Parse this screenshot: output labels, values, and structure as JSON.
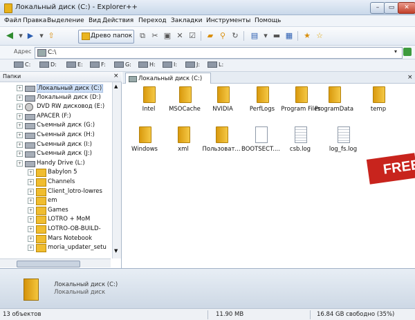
{
  "window": {
    "title": "Локальный диск (C:) - Explorer++"
  },
  "menu": [
    "Файл",
    "Правка",
    "Выделение",
    "Вид",
    "Действия",
    "Переход",
    "Закладки",
    "Инструменты",
    "Помощь"
  ],
  "toolbar": {
    "folders_button": "Древо папок"
  },
  "address": {
    "label": "Адрес",
    "value": "C:\\"
  },
  "drives": [
    "C:",
    "D:",
    "E:",
    "F:",
    "G:",
    "H:",
    "I:",
    "J:",
    "L:"
  ],
  "folders_pane": {
    "title": "Папки",
    "close": "×",
    "items": [
      {
        "label": "Локальный диск (C:)",
        "icon": "drive"
      },
      {
        "label": "Локальный диск (D:)",
        "icon": "drive"
      },
      {
        "label": "DVD RW дисковод (E:)",
        "icon": "cd"
      },
      {
        "label": "APACER (F:)",
        "icon": "drive"
      },
      {
        "label": "Съемный диск (G:)",
        "icon": "drive"
      },
      {
        "label": "Съемный диск (H:)",
        "icon": "drive"
      },
      {
        "label": "Съемный диск (I:)",
        "icon": "drive"
      },
      {
        "label": "Съемный диск (J:)",
        "icon": "drive"
      },
      {
        "label": "Handy Drive (L:)",
        "icon": "drive"
      },
      {
        "label": "Babylon 5",
        "icon": "folder"
      },
      {
        "label": "Channels",
        "icon": "folder"
      },
      {
        "label": "Client_lotro-lowres",
        "icon": "folder"
      },
      {
        "label": "em",
        "icon": "folder"
      },
      {
        "label": "Games",
        "icon": "folder"
      },
      {
        "label": "LOTRO + MoM",
        "icon": "folder"
      },
      {
        "label": "LOTRO-OB-BUILD-",
        "icon": "folder"
      },
      {
        "label": "Mars Notebook",
        "icon": "folder"
      },
      {
        "label": "moria_updater_setu",
        "icon": "folder"
      }
    ]
  },
  "tab": {
    "label": "Локальный диск (C:)",
    "close": "×"
  },
  "files": [
    {
      "name": "Intel",
      "type": "folder"
    },
    {
      "name": "MSOCache",
      "type": "folder"
    },
    {
      "name": "NVIDIA",
      "type": "folder"
    },
    {
      "name": "PerfLogs",
      "type": "folder"
    },
    {
      "name": "Program Files",
      "type": "folder"
    },
    {
      "name": "ProgramData",
      "type": "folder"
    },
    {
      "name": "temp",
      "type": "folder"
    },
    {
      "name": "Windows",
      "type": "folder"
    },
    {
      "name": "xml",
      "type": "folder"
    },
    {
      "name": "Пользоват...",
      "type": "folder"
    },
    {
      "name": "BOOTSECT....",
      "type": "file"
    },
    {
      "name": "csb.log",
      "type": "log"
    },
    {
      "name": "log_fs.log",
      "type": "log"
    }
  ],
  "badge": "FREE",
  "details": {
    "name": "Локальный диск (C:)",
    "type": "Локальный диск"
  },
  "status": {
    "count": "13 объектов",
    "size": "11.90 MB",
    "free": "16.84 GB свободно (35%)"
  }
}
